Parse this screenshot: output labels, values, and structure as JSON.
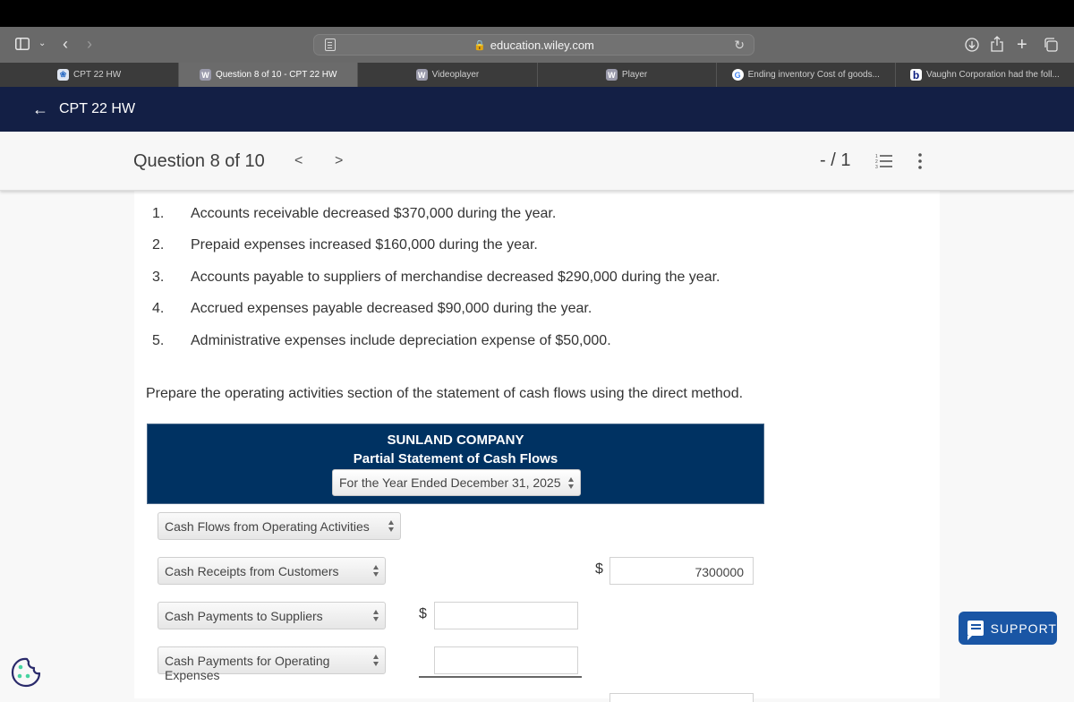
{
  "browser": {
    "url": "education.wiley.com",
    "tabs": [
      {
        "label": "CPT 22 HW",
        "favicon": "leaf-icon",
        "active": false
      },
      {
        "label": "Question 8 of 10 - CPT 22 HW",
        "favicon": "W",
        "active": true
      },
      {
        "label": "Videoplayer",
        "favicon": "W",
        "active": false
      },
      {
        "label": "Player",
        "favicon": "W",
        "active": false
      },
      {
        "label": "Ending inventory Cost of goods...",
        "favicon": "G",
        "active": false
      },
      {
        "label": "Vaughn Corporation had the foll...",
        "favicon": "b",
        "active": false
      }
    ]
  },
  "app_header": {
    "back_icon": "←",
    "title": "CPT 22 HW"
  },
  "question_bar": {
    "title": "Question 8 of 10",
    "prev": "<",
    "next": ">",
    "score": "- / 1"
  },
  "question": {
    "items": [
      {
        "num": "1.",
        "text": "Accounts receivable decreased $370,000 during the year."
      },
      {
        "num": "2.",
        "text": "Prepaid expenses increased $160,000 during the year."
      },
      {
        "num": "3.",
        "text": "Accounts payable to suppliers of merchandise decreased $290,000 during the year."
      },
      {
        "num": "4.",
        "text": "Accrued expenses payable decreased $90,000 during the year."
      },
      {
        "num": "5.",
        "text": "Administrative expenses include depreciation expense of $50,000."
      }
    ],
    "instruction": "Prepare the operating activities section of the statement of cash flows using the direct method."
  },
  "statement": {
    "company": "SUNLAND COMPANY",
    "title": "Partial Statement of Cash Flows",
    "period": "For the Year Ended December 31, 2025",
    "rows": [
      {
        "select": "Cash Flows from Operating Activities"
      },
      {
        "select": "Cash Receipts from Customers",
        "currency": "$",
        "value": "7300000"
      },
      {
        "select": "Cash Payments to Suppliers",
        "currency": "$",
        "value": ""
      },
      {
        "select": "Cash Payments for Operating Expenses",
        "value": ""
      }
    ]
  },
  "support": {
    "label": "SUPPORT"
  }
}
